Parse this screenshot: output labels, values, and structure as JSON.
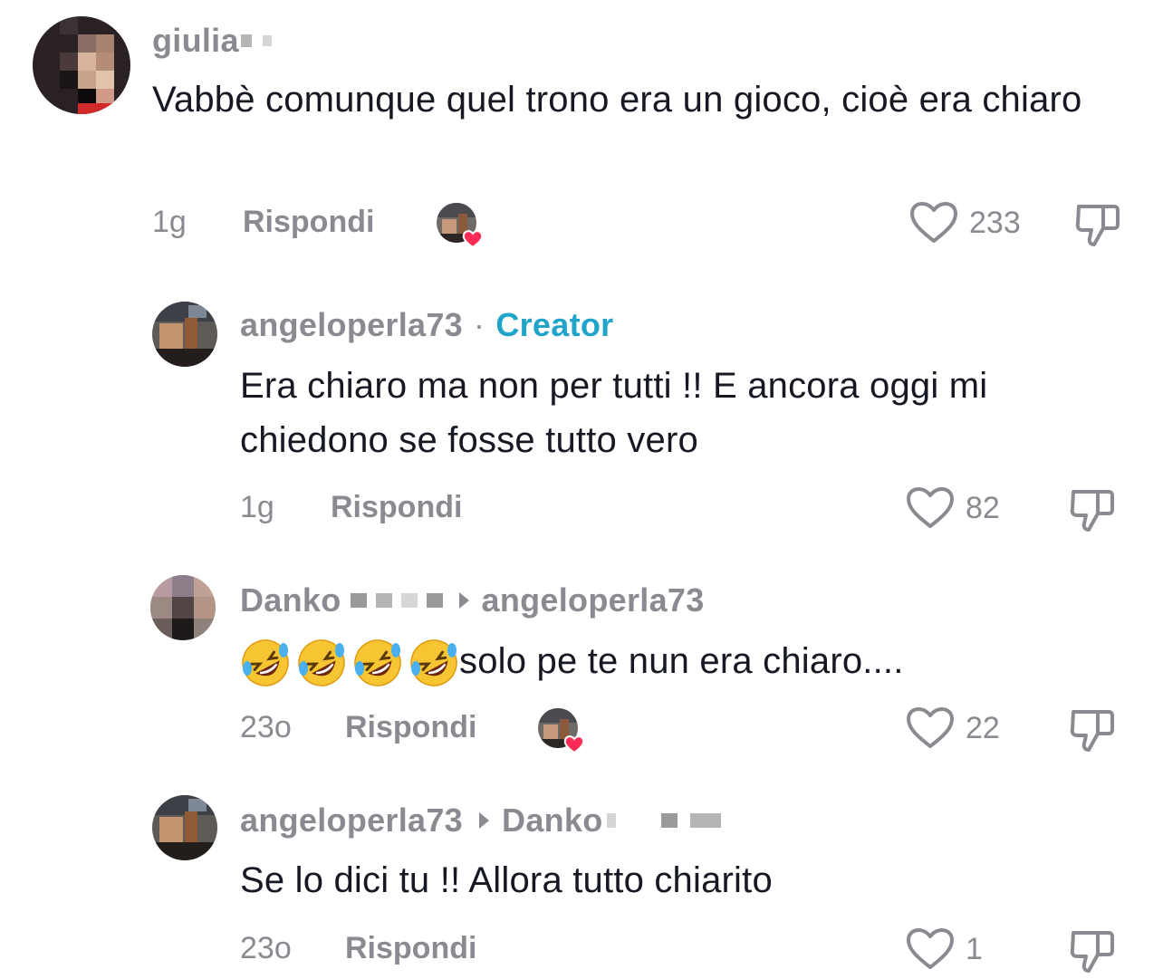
{
  "comments": [
    {
      "username": "giulia",
      "text": "Vabbè comunque quel trono era un gioco, cioè era chiaro",
      "time": "1g",
      "reply_label": "Rispondi",
      "likes": "233",
      "liked_by_creator": true
    },
    {
      "username": "angeloperla73",
      "separator": "·",
      "badge": "Creator",
      "text": "Era chiaro ma non per tutti !! E ancora oggi mi chiedono se fosse tutto vero",
      "time": "1g",
      "reply_label": "Rispondi",
      "likes": "82",
      "liked_by_creator": false
    },
    {
      "username": "Danko",
      "reply_to": "angeloperla73",
      "text": "solo pe te nun era chiaro....",
      "emoji": "rolling-on-floor-laughing",
      "emoji_count": 4,
      "time": "23o",
      "reply_label": "Rispondi",
      "likes": "22",
      "liked_by_creator": true
    },
    {
      "username": "angeloperla73",
      "reply_to": "Danko",
      "text": "Se lo dici tu !! Allora tutto chiarito",
      "time": "23o",
      "reply_label": "Rispondi",
      "likes": "1",
      "liked_by_creator": false
    }
  ],
  "colors": {
    "text": "#161823",
    "muted": "#8a8b91",
    "creator": "#20a4c9",
    "heart_badge": "#fe2c55"
  }
}
